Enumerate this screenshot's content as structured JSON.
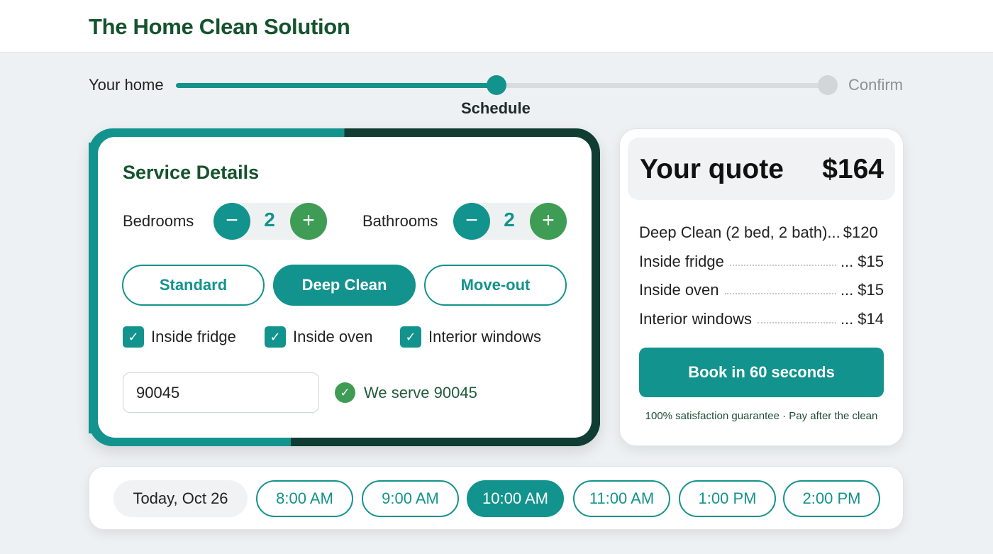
{
  "brand": "The Home Clean Solution",
  "progress": {
    "steps": [
      "Your home",
      "Schedule",
      "Confirm"
    ],
    "current_step": 2,
    "fill_fraction": 0.49
  },
  "service": {
    "title": "Service Details",
    "bedrooms": {
      "label": "Bedrooms",
      "value": "2"
    },
    "bathrooms": {
      "label": "Bathrooms",
      "value": "2"
    },
    "minus_symbol": "−",
    "plus_symbol": "+",
    "clean_types": [
      {
        "label": "Standard",
        "selected": false
      },
      {
        "label": "Deep Clean",
        "selected": true
      },
      {
        "label": "Move-out",
        "selected": false
      }
    ],
    "addons": [
      {
        "label": "Inside fridge",
        "checked": true
      },
      {
        "label": "Inside oven",
        "checked": true
      },
      {
        "label": "Interior windows",
        "checked": true
      }
    ],
    "check_glyph": "✓",
    "zip": {
      "value": "90045",
      "status": "We serve 90045"
    }
  },
  "quote": {
    "title": "Your quote",
    "total": "$164",
    "items": [
      {
        "label": "Deep Clean (2 bed, 2 bath)",
        "dots": " ...",
        "price": "$120"
      },
      {
        "label": "Inside fridge",
        "dots": "...",
        "price": "$15"
      },
      {
        "label": "Inside oven",
        "dots": "...",
        "price": "$15"
      },
      {
        "label": "Interior windows",
        "dots": "...",
        "price": "$14"
      }
    ],
    "book_label": "Book in 60 seconds",
    "guarantee": "100% satisfaction guarantee · Pay after the clean"
  },
  "schedule": {
    "date": "Today, Oct 26",
    "slots": [
      {
        "label": "8:00 AM",
        "selected": false
      },
      {
        "label": "9:00 AM",
        "selected": false
      },
      {
        "label": "10:00 AM",
        "selected": true
      },
      {
        "label": "11:00 AM",
        "selected": false
      },
      {
        "label": "1:00 PM",
        "selected": false
      },
      {
        "label": "2:00 PM",
        "selected": false
      }
    ]
  },
  "colors": {
    "brand_green": "#14532d",
    "teal": "#13938d",
    "dark_green": "#0f3d33",
    "success_green": "#3f9c55"
  }
}
